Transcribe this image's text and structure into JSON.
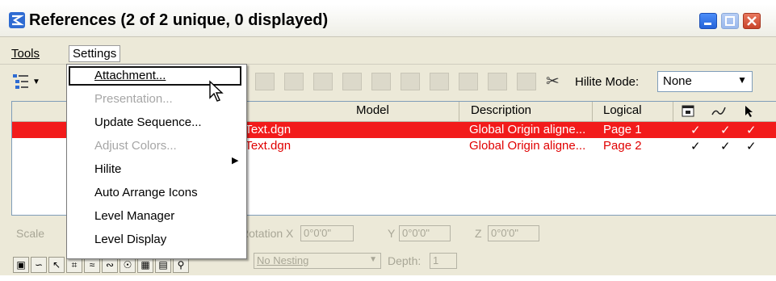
{
  "window": {
    "title": "References (2 of 2 unique, 0 displayed)"
  },
  "menubar": {
    "tools": "Tools",
    "settings": "Settings"
  },
  "toolbar": {
    "hilite_label": "Hilite Mode:",
    "hilite_value": "None"
  },
  "table": {
    "headers": {
      "model": "Model",
      "description": "Description",
      "logical": "Logical"
    },
    "rows": [
      {
        "file": "_Text.dgn",
        "description": "Global Origin aligne...",
        "logical": "Page 1",
        "checks": [
          "✓",
          "✓",
          "✓"
        ]
      },
      {
        "file": "_Text.dgn",
        "description": "Global Origin aligne...",
        "logical": "Page 2",
        "checks": [
          "✓",
          "✓",
          "✓"
        ]
      }
    ]
  },
  "settings_menu": {
    "items": [
      {
        "label": "Attachment...",
        "enabled": true
      },
      {
        "label": "Presentation...",
        "enabled": false
      },
      {
        "label": "Update Sequence...",
        "enabled": true
      },
      {
        "label": "Adjust Colors...",
        "enabled": false
      },
      {
        "label": "Hilite",
        "enabled": true
      },
      {
        "label": "Auto Arrange Icons",
        "enabled": true
      },
      {
        "label": "Level Manager",
        "enabled": true
      },
      {
        "label": "Level Display",
        "enabled": true
      }
    ]
  },
  "lower_panel": {
    "scale_label": "Scale",
    "rotation_x_label": "Rotation X",
    "rotation_x_value": "0°0'0\"",
    "y_label": "Y",
    "y_value": "0°0'0\"",
    "z_label": "Z",
    "z_value": "0°0'0\"",
    "nesting_value": "No Nesting",
    "depth_label": "Depth:",
    "depth_value": "1"
  },
  "colors": {
    "selected_row": "#f21b1b",
    "window_bg": "#ece9d8"
  }
}
